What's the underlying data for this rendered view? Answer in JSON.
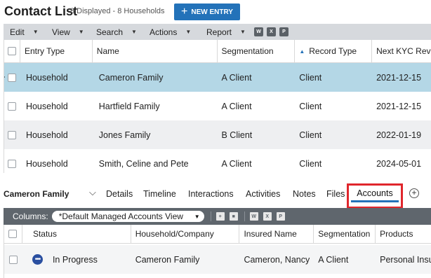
{
  "header": {
    "title": "Contact List",
    "subtitle": "8 Displayed - 8 Households",
    "new_entry_label": "NEW ENTRY"
  },
  "menubar": {
    "items": [
      "Edit",
      "View",
      "Search",
      "Actions",
      "Report"
    ],
    "icons": [
      "word-export-icon",
      "excel-export-icon",
      "print-preview-icon"
    ]
  },
  "contacts_grid": {
    "columns": [
      "Entry Type",
      "Name",
      "Segmentation",
      "Record Type",
      "Next KYC Revi"
    ],
    "sorted_column": "Record Type",
    "rows": [
      {
        "entry_type": "Household",
        "name": "Cameron Family",
        "segmentation": "A Client",
        "record_type": "Client",
        "next_kyc": "2021-12-15",
        "selected": true
      },
      {
        "entry_type": "Household",
        "name": "Hartfield Family",
        "segmentation": "A Client",
        "record_type": "Client",
        "next_kyc": "2021-12-15"
      },
      {
        "entry_type": "Household",
        "name": "Jones Family",
        "segmentation": "B Client",
        "record_type": "Client",
        "next_kyc": "2022-01-19"
      },
      {
        "entry_type": "Household",
        "name": "Smith, Celine and Pete",
        "segmentation": "A Client",
        "record_type": "Client",
        "next_kyc": "2024-05-01"
      }
    ]
  },
  "detail": {
    "record_name": "Cameron Family",
    "tabs": [
      "Details",
      "Timeline",
      "Interactions",
      "Activities",
      "Notes",
      "Files",
      "Accounts"
    ],
    "active_tab": "Accounts"
  },
  "columns_bar": {
    "label": "Columns:",
    "view": "*Default Managed Accounts View"
  },
  "accounts_grid": {
    "columns": [
      "Status",
      "Household/Company",
      "Insured Name",
      "Segmentation",
      "Products"
    ],
    "rows": [
      {
        "status": "In Progress",
        "household": "Cameron Family",
        "insured": "Cameron, Nancy",
        "segmentation": "A Client",
        "products": "Personal Insu"
      }
    ]
  },
  "colors": {
    "accent": "#2372b9",
    "selected_row": "#b4d7e6",
    "highlight": "#e0262c",
    "toolbar": "#d6d9dd",
    "columns_bar": "#5f666d"
  }
}
